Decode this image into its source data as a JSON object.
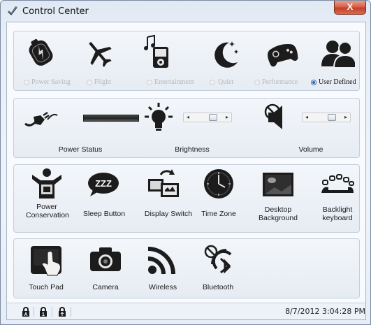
{
  "window": {
    "title": "Control Center",
    "close_glyph": "X"
  },
  "modes": [
    {
      "label": "Power Saving",
      "icon": "power-saving-icon",
      "selected": false
    },
    {
      "label": "Flight",
      "icon": "airplane-icon",
      "selected": false
    },
    {
      "label": "Entertainment",
      "icon": "media-player-icon",
      "selected": false
    },
    {
      "label": "Quiet",
      "icon": "moon-icon",
      "selected": false
    },
    {
      "label": "Performance",
      "icon": "gamepad-icon",
      "selected": false
    },
    {
      "label": "User Defined",
      "icon": "users-icon",
      "selected": true
    }
  ],
  "status_row": {
    "power_status": "Power Status",
    "brightness": "Brightness",
    "volume": "Volume"
  },
  "sliders": {
    "brightness_level": 0.75,
    "volume_level": 0.75,
    "left_arrow": "◂",
    "right_arrow": "▸"
  },
  "tools_row1": [
    {
      "label": "Power\nConservation",
      "icon": "power-conservation-icon"
    },
    {
      "label": "Sleep Button",
      "icon": "sleep-icon"
    },
    {
      "label": "Display Switch",
      "icon": "display-switch-icon"
    },
    {
      "label": "Time Zone",
      "icon": "clock-icon"
    },
    {
      "label": "Desktop\nBackground",
      "icon": "desktop-background-icon"
    },
    {
      "label": "Backlight\nkeyboard",
      "icon": "backlight-keyboard-icon"
    }
  ],
  "tools_row2": [
    {
      "label": "Touch Pad",
      "icon": "touchpad-icon"
    },
    {
      "label": "Camera",
      "icon": "camera-icon"
    },
    {
      "label": "Wireless",
      "icon": "wireless-icon"
    },
    {
      "label": "Bluetooth",
      "icon": "bluetooth-icon"
    }
  ],
  "status_bar": {
    "datetime": "8/7/2012 3:04:28 PM"
  },
  "colors": {
    "accent": "#2a5fb8",
    "close": "#c2412a",
    "icon_dark": "#1c1c1c"
  }
}
